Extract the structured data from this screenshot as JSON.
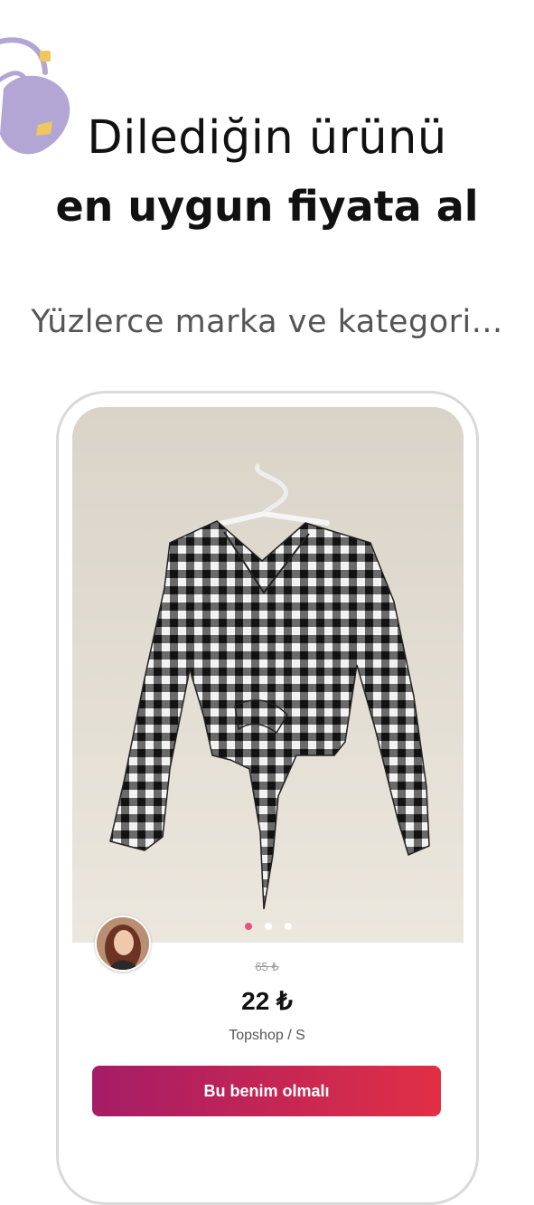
{
  "header": {
    "title_line1": "Dilediğin ürünü",
    "title_line2": "en uygun fiyata al",
    "subtitle": "Yüzlerce marka ve kategori..."
  },
  "decoration": {
    "icon": "handbag-icon",
    "bag_color": "#b3a6d4",
    "clasp_color": "#f0c75e"
  },
  "product_card": {
    "image_icon": "gingham-blouse-photo",
    "carousel": {
      "count": 3,
      "active_index": 0
    },
    "seller_avatar": "seller-avatar",
    "old_price": "65 ₺",
    "price": "22 ₺",
    "brand_size": "Topshop / S",
    "cta_label": "Bu benim olmalı"
  },
  "colors": {
    "cta_start": "#a51c66",
    "cta_end": "#e12f45",
    "active_dot": "#e8507f",
    "text_dark": "#111111",
    "text_muted": "#555555"
  }
}
